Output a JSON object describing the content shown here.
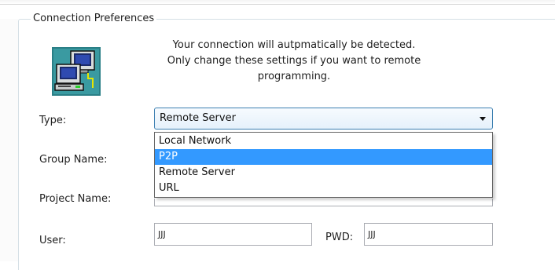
{
  "group": {
    "legend": "Connection Preferences"
  },
  "info": {
    "icon": "network-computers-icon",
    "lines": [
      "Your connection will autpmatically be detected.",
      "Only change these settings if you want to remote",
      "programming."
    ]
  },
  "form": {
    "type_label": "Type:",
    "type_value": "Remote Server",
    "type_options": [
      "Local Network",
      "P2P",
      "Remote Server",
      "URL"
    ],
    "type_highlighted_option": "P2P",
    "group_name_label": "Group Name:",
    "project_name_label": "Project Name:",
    "user_label": "User:",
    "user_value": "JJJ",
    "pwd_label": "PWD:",
    "pwd_value": "JJJ"
  },
  "colors": {
    "highlight": "#3399ff",
    "combo_border": "#3c7fb1",
    "groupbox_border": "#d5dfe5"
  }
}
